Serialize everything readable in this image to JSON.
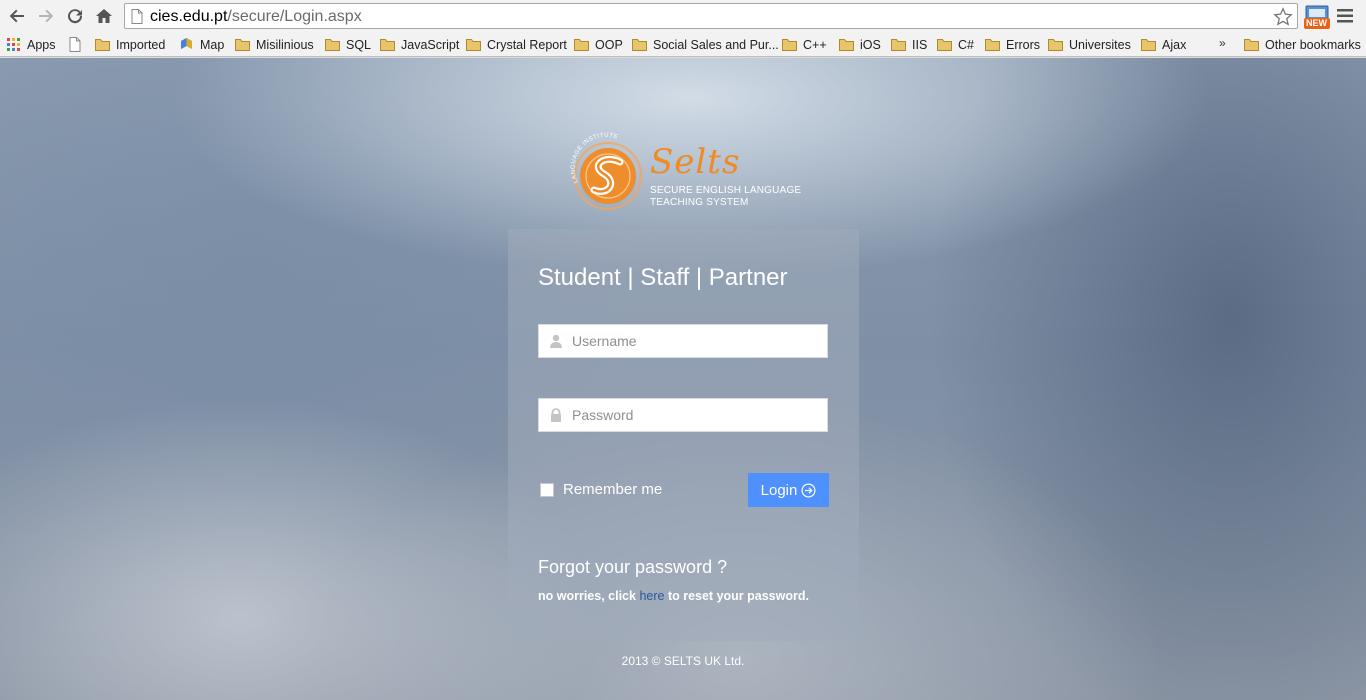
{
  "browser": {
    "url_host": "cies.edu.pt",
    "url_path": "/secure/Login.aspx",
    "ext_badge": "NEW"
  },
  "bookmarks": {
    "items": [
      {
        "label": "Apps",
        "icon": "apps-grid-icon"
      },
      {
        "label": "",
        "icon": "page-icon"
      },
      {
        "label": "Imported",
        "icon": "folder-icon"
      },
      {
        "label": "Map",
        "icon": "maps-icon"
      },
      {
        "label": "Misilinious",
        "icon": "folder-icon"
      },
      {
        "label": "SQL",
        "icon": "folder-icon"
      },
      {
        "label": "JavaScript",
        "icon": "folder-icon"
      },
      {
        "label": "Crystal Report",
        "icon": "folder-icon"
      },
      {
        "label": "OOP",
        "icon": "folder-icon"
      },
      {
        "label": "Social Sales and Pur...",
        "icon": "folder-icon"
      },
      {
        "label": "C++",
        "icon": "folder-icon"
      },
      {
        "label": "iOS",
        "icon": "folder-icon"
      },
      {
        "label": "IIS",
        "icon": "folder-icon"
      },
      {
        "label": "C#",
        "icon": "folder-icon"
      },
      {
        "label": "Errors",
        "icon": "folder-icon"
      },
      {
        "label": "Universites",
        "icon": "folder-icon"
      },
      {
        "label": "Ajax",
        "icon": "folder-icon"
      }
    ],
    "overflow": "»",
    "other": "Other bookmarks"
  },
  "logo": {
    "name": "Selts",
    "tag_line1": "SECURE ENGLISH LANGUAGE",
    "tag_line2": "TEACHING SYSTEM",
    "ring_text": "LANGUAGE INSTITUTE"
  },
  "login": {
    "title": "Student | Staff | Partner",
    "username_placeholder": "Username",
    "password_placeholder": "Password",
    "remember_label": "Remember me",
    "login_label": "Login",
    "forgot_title": "Forgot your password ?",
    "forgot_prefix": "no worries, click ",
    "forgot_link": "here",
    "forgot_suffix": " to reset your password."
  },
  "footer": {
    "text": "2013 © SELTS UK Ltd."
  },
  "colors": {
    "accent": "#4d90fe",
    "brand_orange": "#f08a23",
    "folder": "#e8c46a"
  }
}
